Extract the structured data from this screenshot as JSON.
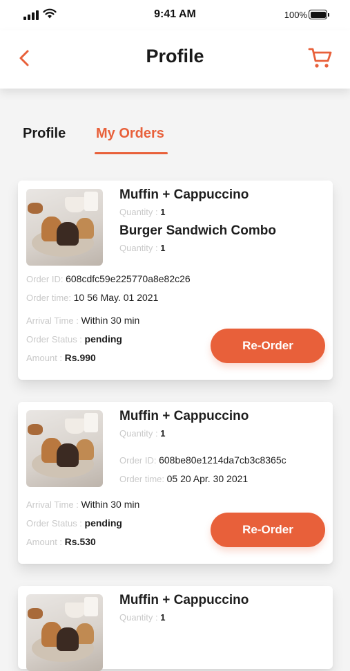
{
  "status_bar": {
    "time": "9:41 AM",
    "battery": "100%"
  },
  "header": {
    "title": "Profile"
  },
  "tabs": {
    "profile": "Profile",
    "orders": "My Orders"
  },
  "labels": {
    "quantity": "Quantity :",
    "order_id": "Order ID:",
    "order_time": "Order time:",
    "arrival_time": "Arrival Time :",
    "order_status": "Order Status :",
    "amount": "Amount :",
    "reorder": "Re-Order"
  },
  "orders": [
    {
      "items": [
        {
          "name": "Muffin + Cappuccino",
          "qty": "1"
        },
        {
          "name": "Burger Sandwich Combo",
          "qty": "1"
        }
      ],
      "order_id": "608cdfc59e225770a8e82c26",
      "order_time": "10 56 May. 01 2021",
      "arrival_time": "Within 30 min",
      "status": "pending",
      "amount": "Rs.990"
    },
    {
      "items": [
        {
          "name": "Muffin + Cappuccino",
          "qty": "1"
        }
      ],
      "order_id": "608be80e1214da7cb3c8365c",
      "order_time": "05 20 Apr. 30 2021",
      "arrival_time": "Within 30 min",
      "status": "pending",
      "amount": "Rs.530"
    },
    {
      "items": [
        {
          "name": "Muffin + Cappuccino",
          "qty": "1"
        }
      ]
    }
  ],
  "colors": {
    "accent": "#e8603a",
    "muted": "#c9c9c9",
    "text": "#1d1d1d"
  }
}
